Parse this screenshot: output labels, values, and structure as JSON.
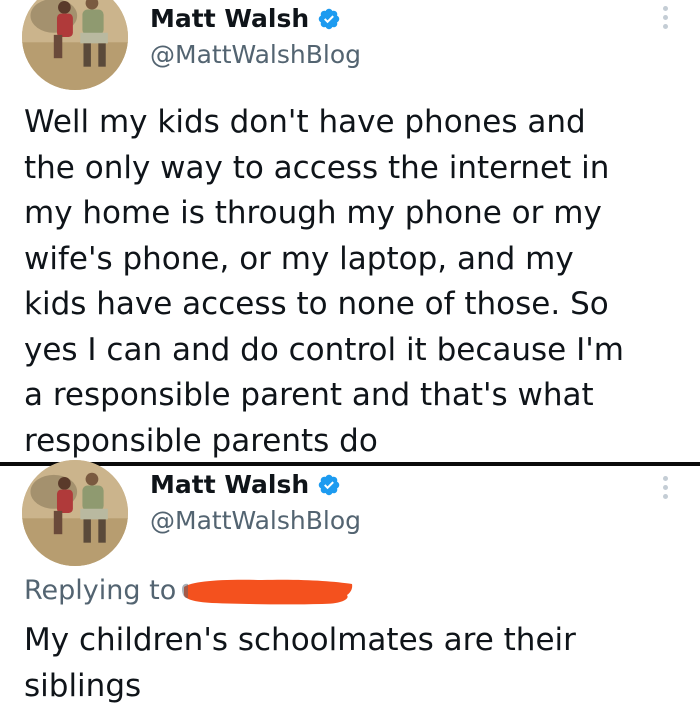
{
  "tweets": [
    {
      "author": {
        "name": "Matt Walsh",
        "handle": "@MattWalshBlog",
        "avatar_icon": "profile-photo",
        "verified_icon": "verified-badge-icon"
      },
      "text": "Well my kids don't have phones and\nthe only way to access the internet in\nmy home is through my phone or my\nwife's phone, or my laptop, and my\nkids have access to none of those. So\nyes I can and do control it because I'm\na responsible parent and that's what\nresponsible parents do"
    },
    {
      "author": {
        "name": "Matt Walsh",
        "handle": "@MattWalshBlog",
        "avatar_icon": "profile-photo",
        "verified_icon": "verified-badge-icon"
      },
      "replying_to_label": "Replying to",
      "text": "My children's schoolmates are their\nsiblings"
    }
  ],
  "colors": {
    "verified": "#1d9bf0",
    "redaction": "#f4511e",
    "secondary_text": "#536471"
  }
}
